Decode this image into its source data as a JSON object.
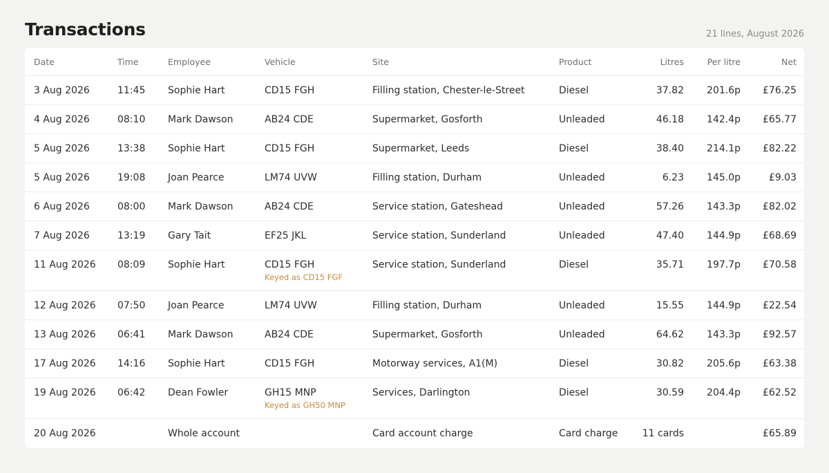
{
  "header": {
    "title": "Transactions",
    "meta": "21 lines, August 2026"
  },
  "columns": {
    "date": "Date",
    "time": "Time",
    "employee": "Employee",
    "vehicle": "Vehicle",
    "site": "Site",
    "product": "Product",
    "litres": "Litres",
    "per_litre": "Per litre",
    "net": "Net"
  },
  "rows": [
    {
      "date": "3 Aug 2026",
      "time": "11:45",
      "employee": "Sophie Hart",
      "vehicle": "CD15 FGH",
      "note": "",
      "site": "Filling station, Chester-le-Street",
      "product": "Diesel",
      "litres": "37.82",
      "per_litre": "201.6p",
      "net": "£76.25"
    },
    {
      "date": "4 Aug 2026",
      "time": "08:10",
      "employee": "Mark Dawson",
      "vehicle": "AB24 CDE",
      "note": "",
      "site": "Supermarket, Gosforth",
      "product": "Unleaded",
      "litres": "46.18",
      "per_litre": "142.4p",
      "net": "£65.77"
    },
    {
      "date": "5 Aug 2026",
      "time": "13:38",
      "employee": "Sophie Hart",
      "vehicle": "CD15 FGH",
      "note": "",
      "site": "Supermarket, Leeds",
      "product": "Diesel",
      "litres": "38.40",
      "per_litre": "214.1p",
      "net": "£82.22"
    },
    {
      "date": "5 Aug 2026",
      "time": "19:08",
      "employee": "Joan Pearce",
      "vehicle": "LM74 UVW",
      "note": "",
      "site": "Filling station, Durham",
      "product": "Unleaded",
      "litres": "6.23",
      "per_litre": "145.0p",
      "net": "£9.03"
    },
    {
      "date": "6 Aug 2026",
      "time": "08:00",
      "employee": "Mark Dawson",
      "vehicle": "AB24 CDE",
      "note": "",
      "site": "Service station, Gateshead",
      "product": "Unleaded",
      "litres": "57.26",
      "per_litre": "143.3p",
      "net": "£82.02"
    },
    {
      "date": "7 Aug 2026",
      "time": "13:19",
      "employee": "Gary Tait",
      "vehicle": "EF25 JKL",
      "note": "",
      "site": "Service station, Sunderland",
      "product": "Unleaded",
      "litres": "47.40",
      "per_litre": "144.9p",
      "net": "£68.69"
    },
    {
      "date": "11 Aug 2026",
      "time": "08:09",
      "employee": "Sophie Hart",
      "vehicle": "CD15 FGH",
      "note": "Keyed as CD15 FGF",
      "site": "Service station, Sunderland",
      "product": "Diesel",
      "litres": "35.71",
      "per_litre": "197.7p",
      "net": "£70.58"
    },
    {
      "date": "12 Aug 2026",
      "time": "07:50",
      "employee": "Joan Pearce",
      "vehicle": "LM74 UVW",
      "note": "",
      "site": "Filling station, Durham",
      "product": "Unleaded",
      "litres": "15.55",
      "per_litre": "144.9p",
      "net": "£22.54"
    },
    {
      "date": "13 Aug 2026",
      "time": "06:41",
      "employee": "Mark Dawson",
      "vehicle": "AB24 CDE",
      "note": "",
      "site": "Supermarket, Gosforth",
      "product": "Unleaded",
      "litres": "64.62",
      "per_litre": "143.3p",
      "net": "£92.57"
    },
    {
      "date": "17 Aug 2026",
      "time": "14:16",
      "employee": "Sophie Hart",
      "vehicle": "CD15 FGH",
      "note": "",
      "site": "Motorway services, A1(M)",
      "product": "Diesel",
      "litres": "30.82",
      "per_litre": "205.6p",
      "net": "£63.38"
    },
    {
      "date": "19 Aug 2026",
      "time": "06:42",
      "employee": "Dean Fowler",
      "vehicle": "GH15 MNP",
      "note": "Keyed as GH50 MNP",
      "site": "Services, Darlington",
      "product": "Diesel",
      "litres": "30.59",
      "per_litre": "204.4p",
      "net": "£62.52"
    },
    {
      "date": "20 Aug 2026",
      "time": "",
      "employee": "Whole account",
      "vehicle": "",
      "note": "",
      "site": "Card account charge",
      "product": "Card charge",
      "litres": "11 cards",
      "per_litre": "",
      "net": "£65.89"
    }
  ],
  "colors": {
    "background": "#f3f3f1",
    "card": "#ffffff",
    "note": "#cd8a3c",
    "divider": "#ebebe8"
  }
}
